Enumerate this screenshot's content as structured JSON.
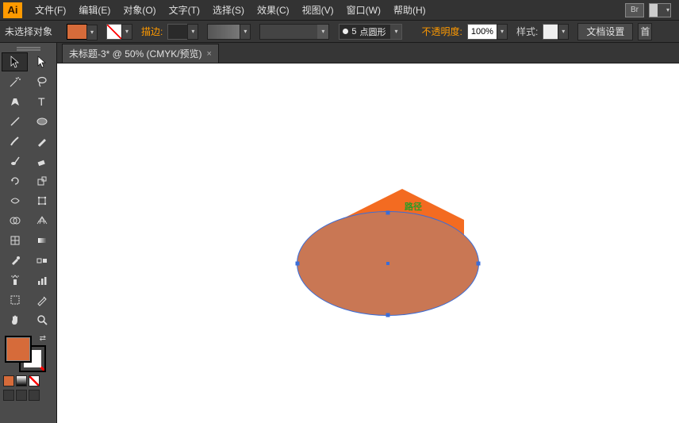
{
  "app": {
    "logo": "Ai"
  },
  "menu": {
    "file": "文件(F)",
    "edit": "编辑(E)",
    "object": "对象(O)",
    "type": "文字(T)",
    "select": "选择(S)",
    "effect": "效果(C)",
    "view": "视图(V)",
    "window": "窗口(W)",
    "help": "帮助(H)",
    "br": "Br"
  },
  "control": {
    "selection": "未选择对象",
    "stroke_label": "描边:",
    "stroke_weight": "",
    "brush_size": "5",
    "brush_name": "点圆形",
    "opacity_label": "不透明度:",
    "opacity_value": "100%",
    "style_label": "样式:",
    "doc_setup": "文档设置",
    "trunc": "首"
  },
  "colors": {
    "fill": "#d66b3a",
    "hex_shape": "#f36b21",
    "ellipse_shape": "#c97754",
    "selection_blue": "#3a6dd8"
  },
  "tab": {
    "title": "未标题-3* @ 50% (CMYK/预览)",
    "close": "×"
  },
  "canvas": {
    "path_label": "路径"
  }
}
